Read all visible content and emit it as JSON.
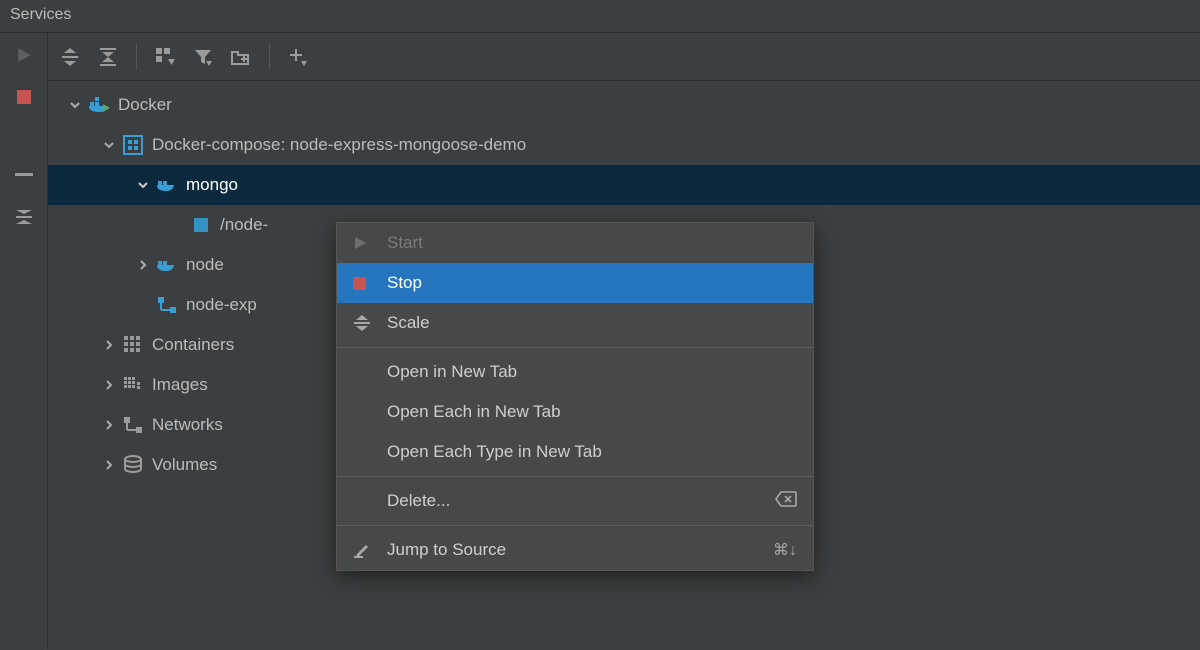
{
  "panel": {
    "title": "Services"
  },
  "tree": {
    "root": "Docker",
    "compose": "Docker-compose: node-express-mongoose-demo",
    "mongo": "mongo",
    "mongo_child": "/node-",
    "node": "node",
    "node_express": "node-exp",
    "containers": "Containers",
    "images": "Images",
    "networks": "Networks",
    "volumes": "Volumes"
  },
  "menu": {
    "start": "Start",
    "stop": "Stop",
    "scale": "Scale",
    "open_new_tab": "Open in New Tab",
    "open_each_new_tab": "Open Each in New Tab",
    "open_each_type_new_tab": "Open Each Type in New Tab",
    "delete": "Delete...",
    "jump": "Jump to Source",
    "jump_shortcut": "⌘↓"
  }
}
